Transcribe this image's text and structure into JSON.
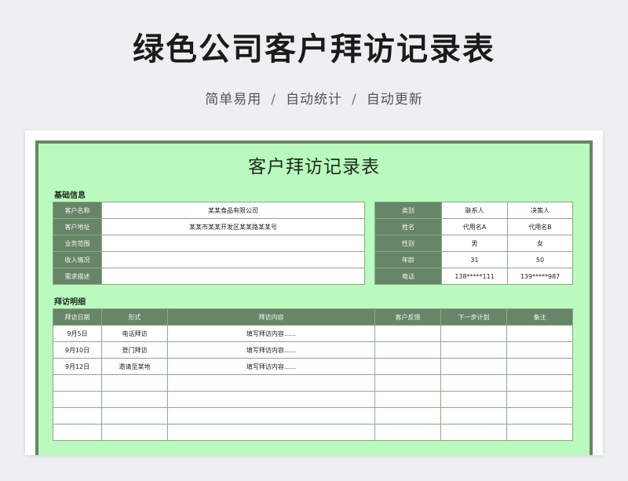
{
  "header": {
    "title": "绿色公司客户拜访记录表",
    "tags": [
      "简单易用",
      "自动统计",
      "自动更新"
    ],
    "separator": "/"
  },
  "sheet": {
    "title": "客户拜访记录表",
    "basic_section_label": "基础信息",
    "basic_left": [
      {
        "label": "客户名称",
        "value": "某某食品有限公司"
      },
      {
        "label": "客户地址",
        "value": "某某市某某开发区某某路某某号"
      },
      {
        "label": "业务范围",
        "value": ""
      },
      {
        "label": "收入情况",
        "value": ""
      },
      {
        "label": "需求描述",
        "value": ""
      }
    ],
    "basic_right": [
      {
        "label": "类别",
        "a": "联系人",
        "b": "决策人"
      },
      {
        "label": "姓名",
        "a": "代用名A",
        "b": "代用名B"
      },
      {
        "label": "性别",
        "a": "男",
        "b": "女"
      },
      {
        "label": "年龄",
        "a": "31",
        "b": "50"
      },
      {
        "label": "电话",
        "a": "138*****111",
        "b": "139*****987"
      }
    ],
    "visit_section_label": "拜访明细",
    "visit_columns": [
      "拜访日期",
      "形式",
      "拜访内容",
      "客户反馈",
      "下一步计划",
      "备注"
    ],
    "visit_rows": [
      [
        "9月5日",
        "电话拜访",
        "填写拜访内容......",
        "",
        "",
        ""
      ],
      [
        "9月10日",
        "登门拜访",
        "填写拜访内容......",
        "",
        "",
        ""
      ],
      [
        "9月12日",
        "邀请至某地",
        "填写拜访内容......",
        "",
        "",
        ""
      ],
      [
        "",
        "",
        "",
        "",
        "",
        ""
      ],
      [
        "",
        "",
        "",
        "",
        "",
        ""
      ],
      [
        "",
        "",
        "",
        "",
        "",
        ""
      ],
      [
        "",
        "",
        "",
        "",
        "",
        ""
      ]
    ]
  },
  "colors": {
    "header_green": "#678567",
    "sheet_bg": "#bbfabf",
    "page_bg": "#eeeff1"
  }
}
